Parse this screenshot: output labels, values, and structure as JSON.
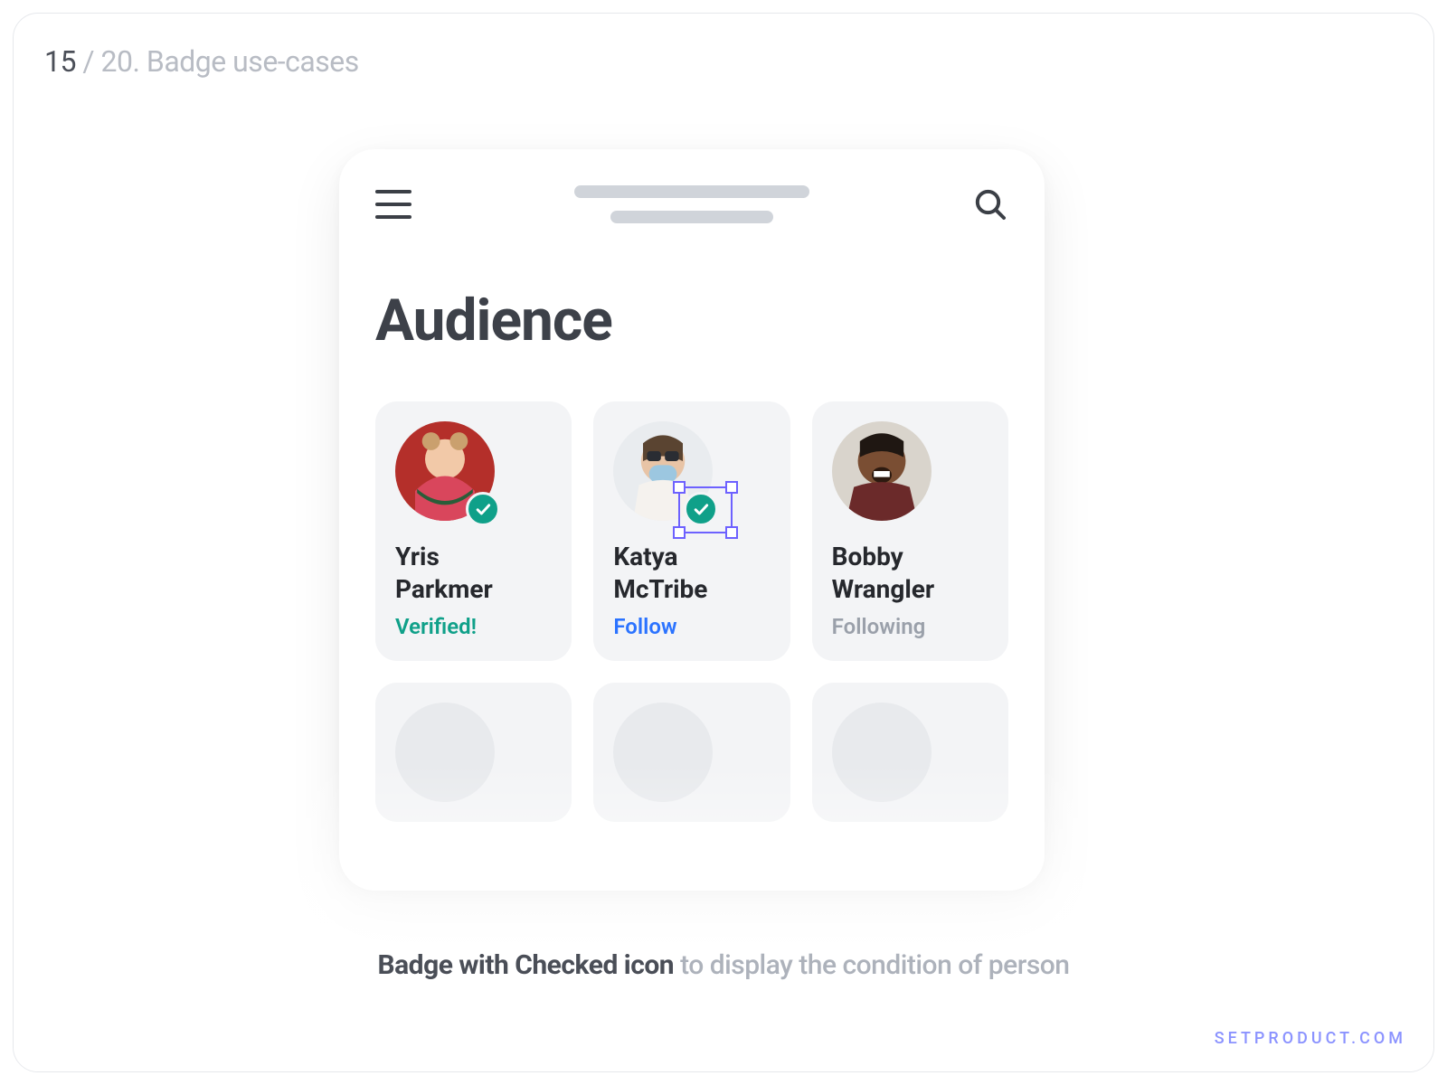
{
  "breadcrumb": {
    "current": "15",
    "sep": " / ",
    "rest": "20. Badge use-cases"
  },
  "heading": "Audience",
  "cards": [
    {
      "name_line1": "Yris",
      "name_line2": "Parkmer",
      "status": "Verified!",
      "status_kind": "verified",
      "verified": true
    },
    {
      "name_line1": "Katya",
      "name_line2": "McTribe",
      "status": "Follow",
      "status_kind": "follow",
      "verified": true,
      "selected": true
    },
    {
      "name_line1": "Bobby",
      "name_line2": "Wrangler",
      "status": "Following",
      "status_kind": "following",
      "verified": false
    }
  ],
  "caption": {
    "strong": "Badge with Checked icon",
    "rest": " to display the condition of person"
  },
  "brand": "SETPRODUCT.COM"
}
